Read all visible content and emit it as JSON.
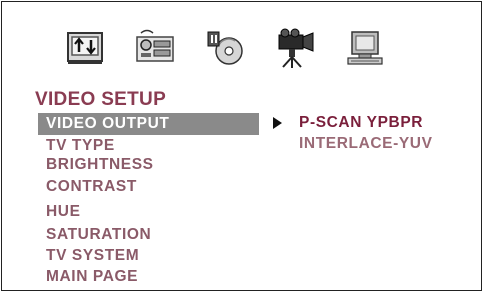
{
  "tabs": [
    {
      "name": "general-setup-icon"
    },
    {
      "name": "audio-setup-icon"
    },
    {
      "name": "dolby-disc-icon"
    },
    {
      "name": "video-camera-icon"
    },
    {
      "name": "computer-preference-icon"
    }
  ],
  "section_title": "VIDEO SETUP",
  "menu": {
    "items": [
      {
        "label": "VIDEO OUTPUT",
        "active": true
      },
      {
        "label": "TV TYPE",
        "active": false
      },
      {
        "label": "BRIGHTNESS",
        "active": false
      },
      {
        "label": "CONTRAST",
        "active": false
      },
      {
        "label": "HUE",
        "active": false
      },
      {
        "label": "SATURATION",
        "active": false
      },
      {
        "label": "TV SYSTEM",
        "active": false
      },
      {
        "label": "MAIN PAGE",
        "active": false
      }
    ]
  },
  "submenu": {
    "options": [
      {
        "label": "P-SCAN YPBPR",
        "selected": true
      },
      {
        "label": "INTERLACE-YUV",
        "selected": false
      }
    ]
  },
  "colors": {
    "title": "#8a3c52",
    "menu_text": "#8a5a68",
    "highlight_bg": "#8a8a8a",
    "highlight_text": "#ffffff",
    "selected_option": "#7a1f3b"
  }
}
